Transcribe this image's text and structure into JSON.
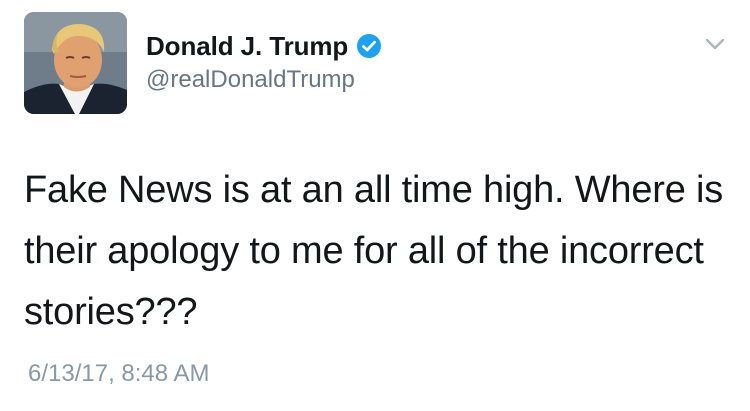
{
  "author": {
    "display_name": "Donald J. Trump",
    "handle": "@realDonaldTrump",
    "verified": true
  },
  "tweet": {
    "text": "Fake News is at an all time high. Where is their apology to me for all of the incorrect stories???",
    "timestamp": "6/13/17, 8:48 AM"
  },
  "icons": {
    "verified": "verified-badge-icon",
    "menu": "chevron-down-icon"
  },
  "colors": {
    "verified_blue": "#1da1f2",
    "handle_gray": "#657786",
    "timestamp_gray": "#8899a6",
    "text": "#14171a"
  }
}
